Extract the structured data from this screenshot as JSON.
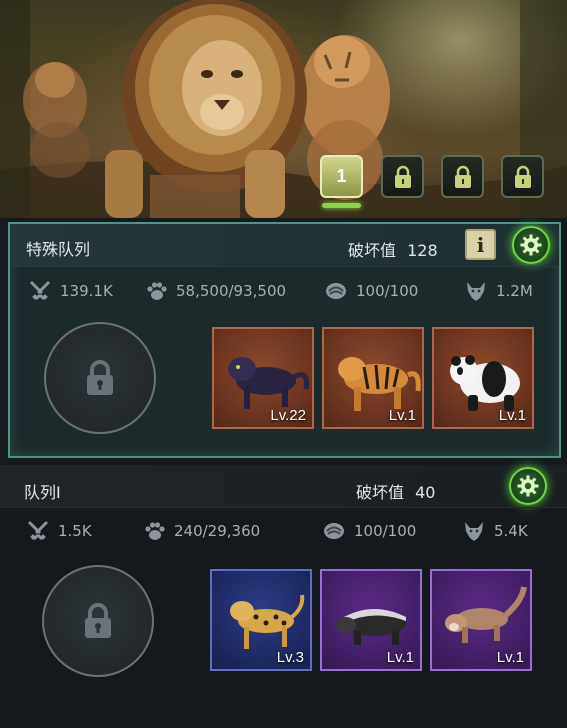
{
  "hero": {
    "queue_tabs": [
      {
        "label": "1",
        "state": "active"
      },
      {
        "label": "",
        "state": "locked",
        "icon": "lock-icon"
      },
      {
        "label": "",
        "state": "locked",
        "icon": "lock-icon"
      },
      {
        "label": "",
        "state": "locked",
        "icon": "lock-icon"
      }
    ]
  },
  "squads": [
    {
      "title": "特殊队列",
      "damage_label": "破坏值",
      "damage_value": "128",
      "info_label": "i",
      "stats": {
        "attack": "139.1K",
        "capacity": "58,500/93,500",
        "stamina": "100/100",
        "power": "1.2M"
      },
      "lock_icon": "lock-icon",
      "animals": [
        {
          "name": "black-panther",
          "level": "Lv.22",
          "frame": "brown"
        },
        {
          "name": "tiger",
          "level": "Lv.1",
          "frame": "brown"
        },
        {
          "name": "panda",
          "level": "Lv.1",
          "frame": "brown"
        }
      ]
    },
    {
      "title": "队列I",
      "damage_label": "破坏值",
      "damage_value": "40",
      "stats": {
        "attack": "1.5K",
        "capacity": "240/29,360",
        "stamina": "100/100",
        "power": "5.4K"
      },
      "lock_icon": "lock-icon",
      "animals": [
        {
          "name": "leopard-cat",
          "level": "Lv.3",
          "frame": "blue"
        },
        {
          "name": "honey-badger",
          "level": "Lv.1",
          "frame": "purple"
        },
        {
          "name": "weasel",
          "level": "Lv.1",
          "frame": "purple"
        }
      ]
    }
  ],
  "colors": {
    "accent_green": "#6fd846",
    "special_border": "#4f9585",
    "frame_brown": "#b0664a",
    "frame_blue": "#5d6fc0",
    "frame_purple": "#9a6fd0"
  }
}
